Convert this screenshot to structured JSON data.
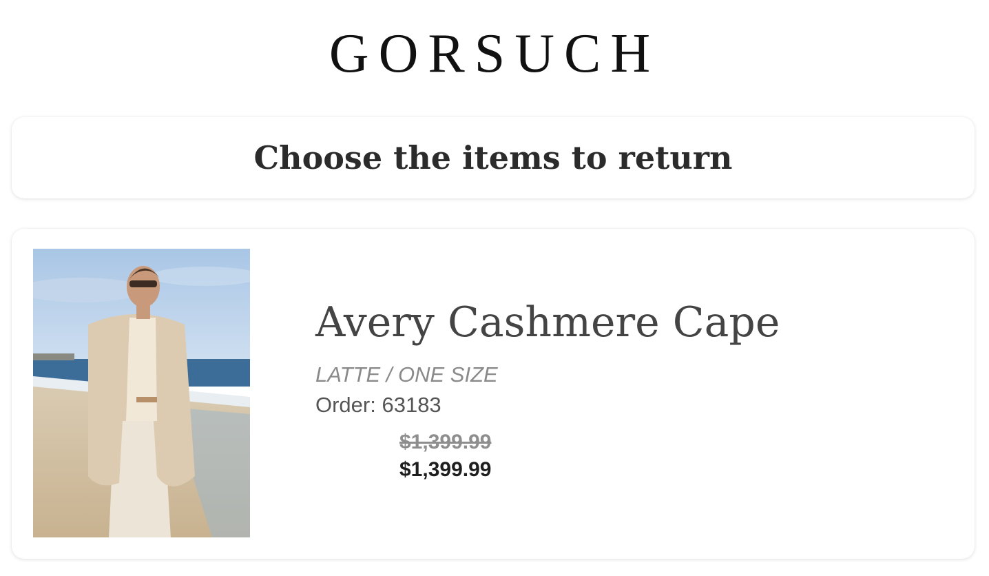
{
  "brand": {
    "logo_text": "GORSUCH"
  },
  "header": {
    "title": "Choose the items to return"
  },
  "items": [
    {
      "name": "Avery Cashmere Cape",
      "variant": "LATTE / ONE SIZE",
      "order": "Order: 63183",
      "original_price": "$1,399.99",
      "price": "$1,399.99",
      "image_icon": "product-photo"
    }
  ]
}
